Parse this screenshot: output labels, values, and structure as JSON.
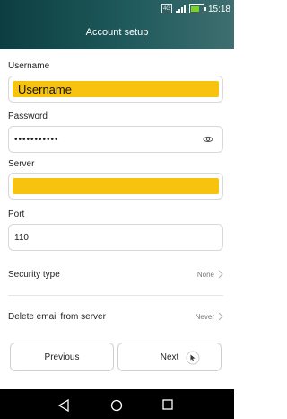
{
  "status_bar": {
    "time": "15:18",
    "badge_text": "4G"
  },
  "header": {
    "title": "Account setup"
  },
  "form": {
    "username": {
      "label": "Username",
      "value": "Username"
    },
    "password": {
      "label": "Password",
      "value": "•••••••••••"
    },
    "server": {
      "label": "Server",
      "value": ""
    },
    "port": {
      "label": "Port",
      "value": "110"
    }
  },
  "settings": {
    "security_type": {
      "label": "Security type",
      "value": "None"
    },
    "delete_email": {
      "label": "Delete email from server",
      "value": "Never"
    }
  },
  "buttons": {
    "previous": "Previous",
    "next": "Next"
  },
  "colors": {
    "header_dark": "#0c3e40",
    "highlight_yellow": "#f7c30f",
    "battery_green": "#7bd321"
  },
  "icons": [
    "eye-icon",
    "chevron-right-icon",
    "back-triangle-icon",
    "home-circle-icon",
    "recent-apps-square-icon",
    "signal-icon",
    "battery-icon"
  ]
}
